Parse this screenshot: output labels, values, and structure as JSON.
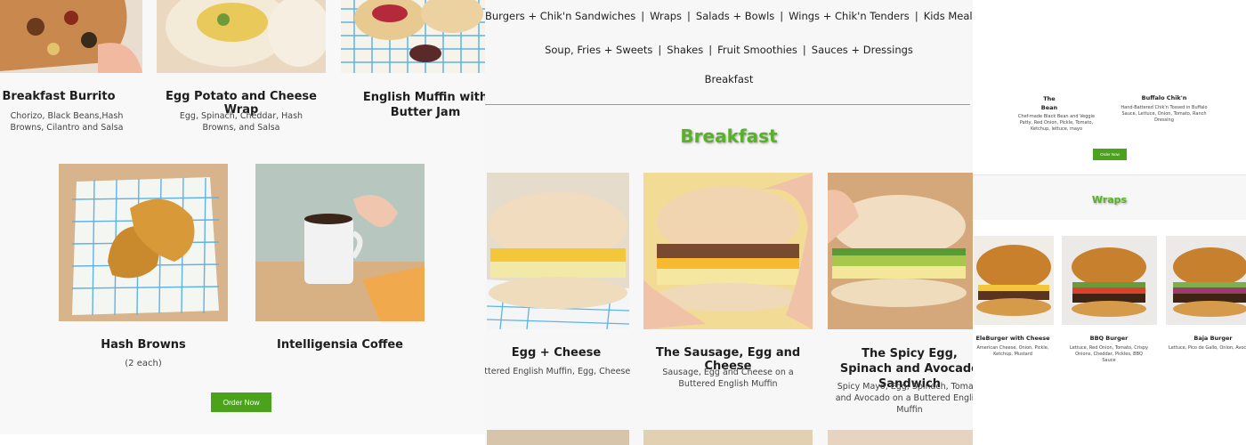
{
  "panel1": {
    "items_top": [
      {
        "name": "Breakfast Burrito",
        "desc": "Chorizo, Black Beans,Hash Browns, Cilantro and Salsa"
      },
      {
        "name": "Egg Potato and Cheese Wrap",
        "desc": "Egg, Spinach, Cheddar, Hash Browns, and Salsa"
      },
      {
        "name": "English Muffin with Butter Jam",
        "desc": ""
      }
    ],
    "items_bottom": [
      {
        "name": "Hash Browns",
        "desc": "(2 each)"
      },
      {
        "name": "Intelligensia Coffee",
        "desc": ""
      }
    ],
    "order_label": "Order Now"
  },
  "panel2": {
    "nav_row1": [
      "Burgers + Chik'n Sandwiches",
      "Wraps",
      "Salads + Bowls",
      "Wings + Chik'n Tenders",
      "Kids Meals"
    ],
    "nav_row2": [
      "Soup, Fries + Sweets",
      "Shakes",
      "Fruit Smoothies",
      "Sauces + Dressings"
    ],
    "nav_row3": [
      "Breakfast"
    ],
    "section_title": "Breakfast",
    "items": [
      {
        "name": "Egg + Cheese",
        "desc": "Buttered English Muffin, Egg, Cheese"
      },
      {
        "name": "The Sausage, Egg and Cheese",
        "desc": "Sausage, Egg and Cheese on a Buttered English Muffin"
      },
      {
        "name": "The Spicy Egg, Spinach and Avocado Sandwich",
        "desc": "Spicy Mayo, Egg, Spinach, Tomato and Avocado on a Buttered English Muffin"
      }
    ]
  },
  "panel3": {
    "top_items": [
      {
        "name": "The Bean",
        "desc": "Chef-made Black Bean and Veggie Patty, Red Onion, Pickle, Tomato, Ketchup, lettuce, mayo"
      },
      {
        "name": "Buffalo Chik'n",
        "desc": "Hand-Battered Chik'n Tossed in Buffalo Sauce, Lettuce, Onion, Tomato, Ranch Dressing"
      }
    ],
    "order_label": "Order Now",
    "section_title": "Wraps",
    "items": [
      {
        "name": "EleBurger with Cheese",
        "desc": "American Cheese, Onion, Pickle, Ketchup, Mustard"
      },
      {
        "name": "BBQ Burger",
        "desc": "Lettuce, Red Onion, Tomato, Crispy Onions, Cheddar, Pickles, BBQ Sauce"
      },
      {
        "name": "Baja Burger",
        "desc": "Lettuce, Pico de Gallo, Onion, Avocado, Sriracha Aioli"
      }
    ]
  },
  "colors": {
    "accent": "#4aa31a",
    "title_green": "#58b227"
  }
}
